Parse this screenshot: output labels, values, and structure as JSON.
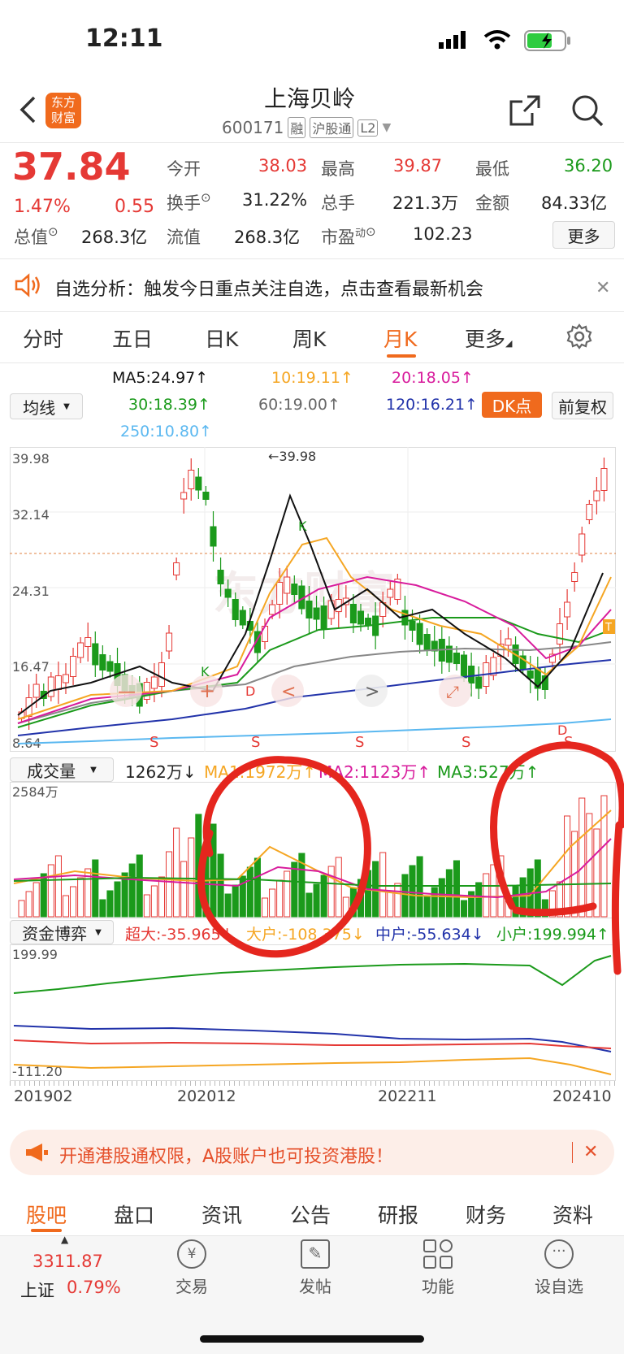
{
  "status_bar": {
    "time": "12:11"
  },
  "header": {
    "logo_top": "东方",
    "logo_bottom": "财富",
    "title": "上海贝岭",
    "code": "600171",
    "badge1": "融",
    "badge2": "沪股通",
    "badge3": "L2"
  },
  "quote": {
    "price": "37.84",
    "change_pct": "1.47%",
    "change": "0.55",
    "open_label": "今开",
    "open": "38.03",
    "high_label": "最高",
    "high": "39.87",
    "low_label": "最低",
    "low": "36.20",
    "turnover_label": "换手",
    "turnover": "31.22%",
    "volume_label": "总手",
    "volume": "221.3万",
    "amount_label": "金额",
    "amount": "84.33亿",
    "mcap_label": "总值",
    "mcap": "268.3亿",
    "float_label": "流值",
    "float": "268.3亿",
    "pe_label": "市盈",
    "pe_sup": "动",
    "pe": "102.23",
    "more_button": "更多"
  },
  "banner": {
    "text": "自选分析：触发今日重点关注自选，点击查看最新机会"
  },
  "tabs": [
    "分时",
    "五日",
    "日K",
    "周K",
    "月K",
    "更多"
  ],
  "active_tab": "月K",
  "indicators": {
    "ma_dropdown": "均线",
    "ma5": "MA5:24.97↑",
    "ma10": "10:19.11↑",
    "ma20": "20:18.05↑",
    "ma30": "30:18.39↑",
    "ma60": "60:19.00↑",
    "ma120": "120:16.21↑",
    "ma250": "250:10.80↑",
    "dk_button": "DK点",
    "fq_button": "前复权"
  },
  "main_chart": {
    "y_ticks": [
      "39.98",
      "32.14",
      "24.31",
      "16.47",
      "8.64"
    ],
    "peak_label": "←39.98",
    "ctrl": [
      "—",
      "+",
      "<",
      ">"
    ],
    "marks": [
      "S",
      "S",
      "S",
      "S",
      "S",
      "K",
      "K",
      "D",
      "D"
    ]
  },
  "volume": {
    "dropdown": "成交量",
    "value": "1262万↓",
    "ma1": "MA1:1972万↑",
    "ma2": "MA2:1123万↑",
    "ma3": "MA3:527万↑",
    "y_top": "2584万"
  },
  "money_flow": {
    "dropdown": "资金博弈",
    "super": "超大:-35.965↓",
    "large": "大户:-108.375↓",
    "mid": "中户:-55.634↓",
    "small": "小户:199.994↑",
    "y_top": "199.99",
    "y_bottom": "-111.20"
  },
  "x_axis": [
    "201902",
    "202012",
    "202211",
    "202410"
  ],
  "promo": {
    "text": "开通港股通权限，A股账户也可投资港股！"
  },
  "bottom_tabs": [
    "股吧",
    "盘口",
    "资讯",
    "公告",
    "研报",
    "财务",
    "资料"
  ],
  "nav": {
    "index_value": "3311.87",
    "index_name": "上证",
    "index_pct": "0.79%",
    "items": [
      "交易",
      "发帖",
      "功能",
      "设自选"
    ]
  },
  "chart_data": {
    "type": "candlestick",
    "title": "",
    "y_range": [
      8.64,
      39.98
    ],
    "peak": 39.98,
    "current_ma": {
      "MA5": 24.97,
      "MA10": 19.11,
      "MA20": 18.05,
      "MA30": 18.39,
      "MA60": 19.0,
      "MA120": 16.21,
      "MA250": 10.8
    },
    "x_labels": [
      "201902",
      "202012",
      "202211",
      "202410"
    ]
  },
  "colors": {
    "up": "#e53935",
    "down": "#1b9a1b",
    "accent": "#f06a1d"
  }
}
